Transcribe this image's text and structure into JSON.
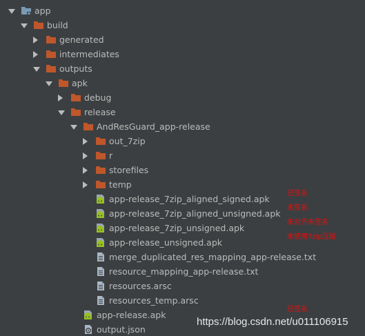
{
  "tree": [
    {
      "label": "app",
      "type": "module",
      "state": "expanded",
      "level": 0
    },
    {
      "label": "build",
      "type": "folder",
      "state": "expanded",
      "level": 1
    },
    {
      "label": "generated",
      "type": "folder",
      "state": "collapsed",
      "level": 2
    },
    {
      "label": "intermediates",
      "type": "folder",
      "state": "collapsed",
      "level": 2
    },
    {
      "label": "outputs",
      "type": "folder",
      "state": "expanded",
      "level": 2
    },
    {
      "label": "apk",
      "type": "folder",
      "state": "expanded",
      "level": 3
    },
    {
      "label": "debug",
      "type": "folder",
      "state": "collapsed",
      "level": 4
    },
    {
      "label": "release",
      "type": "folder",
      "state": "expanded",
      "level": 4
    },
    {
      "label": "AndResGuard_app-release",
      "type": "folder",
      "state": "expanded",
      "level": 5
    },
    {
      "label": "out_7zip",
      "type": "folder",
      "state": "collapsed",
      "level": 6
    },
    {
      "label": "r",
      "type": "folder",
      "state": "collapsed",
      "level": 6
    },
    {
      "label": "storefiles",
      "type": "folder",
      "state": "collapsed",
      "level": 6
    },
    {
      "label": "temp",
      "type": "folder",
      "state": "collapsed",
      "level": 6
    },
    {
      "label": "app-release_7zip_aligned_signed.apk",
      "type": "apk",
      "level": 6
    },
    {
      "label": "app-release_7zip_aligned_unsigned.apk",
      "type": "apk",
      "level": 6
    },
    {
      "label": "app-release_7zip_unsigned.apk",
      "type": "apk",
      "level": 6
    },
    {
      "label": "app-release_unsigned.apk",
      "type": "apk",
      "level": 6
    },
    {
      "label": "merge_duplicated_res_mapping_app-release.txt",
      "type": "text",
      "level": 6
    },
    {
      "label": "resource_mapping_app-release.txt",
      "type": "text",
      "level": 6
    },
    {
      "label": "resources.arsc",
      "type": "text",
      "level": 6
    },
    {
      "label": "resources_temp.arsc",
      "type": "text",
      "level": 6
    },
    {
      "label": "app-release.apk",
      "type": "apk",
      "level": 5
    },
    {
      "label": "output.json",
      "type": "json",
      "level": 5
    }
  ],
  "annotations": [
    {
      "row": 13,
      "text": "已签名"
    },
    {
      "row": 14,
      "text": "未签名"
    },
    {
      "row": 15,
      "text": "未对齐未签名"
    },
    {
      "row": 16,
      "text": "未使用7zip压缩"
    },
    {
      "row": 21,
      "text": "已签名"
    }
  ],
  "watermark": "https://blog.csdn.net/u011106915",
  "colors": {
    "background": "#3c3f41",
    "text": "#bbbbbb",
    "folder": "#c0572b",
    "module_folder": "#7a9bb5",
    "android_green": "#97c024",
    "file_gray": "#a9b7c6",
    "annotation": "#e01010"
  }
}
